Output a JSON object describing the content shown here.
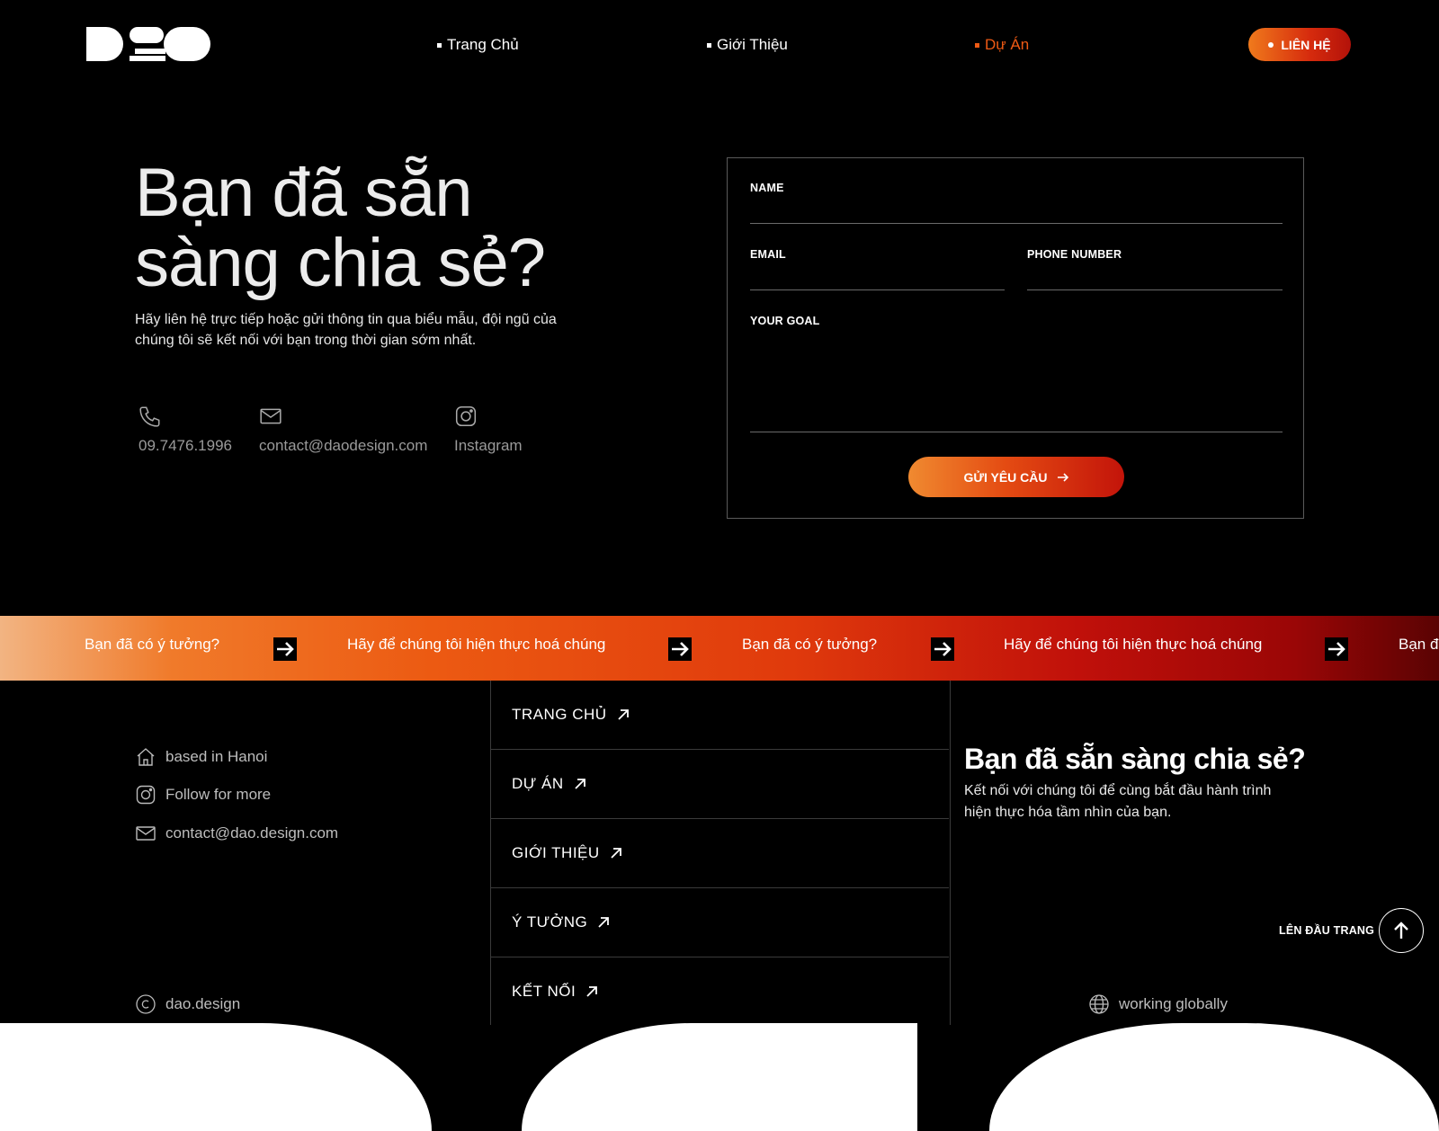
{
  "header": {
    "logo_text": "DAO",
    "nav": [
      {
        "label": "Trang Chủ",
        "active": false
      },
      {
        "label": "Giới Thiệu",
        "active": false
      },
      {
        "label": "Dự Án",
        "active": true
      }
    ],
    "contact_button": "LIÊN HỆ"
  },
  "hero": {
    "title_line1": "Bạn đã sẵn",
    "title_line2": "sàng chia sẻ?",
    "description": "Hãy liên hệ trực tiếp hoặc gửi thông tin qua biểu mẫu, đội ngũ của chúng tôi sẽ kết nối với bạn trong thời gian sớm nhất.",
    "contacts": [
      {
        "icon": "phone-icon",
        "value": "09.7476.1996"
      },
      {
        "icon": "mail-icon",
        "value": "contact@daodesign.com"
      },
      {
        "icon": "instagram-icon",
        "value": "Instagram"
      }
    ]
  },
  "form": {
    "name_label": "NAME",
    "email_label": "EMAIL",
    "phone_label": "PHONE NUMBER",
    "goal_label": "YOUR GOAL",
    "name_value": "",
    "email_value": "",
    "phone_value": "",
    "goal_value": "",
    "submit_label": "GỬI YÊU CẦU"
  },
  "marquee": {
    "items": [
      "Bạn đã có ý tưởng?",
      "Hãy để chúng tôi hiện thực hoá chúng",
      "Bạn đã có ý tưởng?",
      "Hãy để chúng tôi hiện thực hoá chúng",
      "Bạn đ"
    ]
  },
  "footer": {
    "info": [
      {
        "icon": "home-icon",
        "text": "based in Hanoi"
      },
      {
        "icon": "instagram-icon",
        "text": "Follow for more"
      },
      {
        "icon": "mail-icon",
        "text": "contact@dao.design.com"
      }
    ],
    "copyright": "dao.design",
    "menu": [
      {
        "label": "TRANG CHỦ"
      },
      {
        "label": "DỰ ÁN"
      },
      {
        "label": "GIỚI THIỆU"
      },
      {
        "label": "Ý TƯỞNG"
      },
      {
        "label": "KẾT NỐI"
      }
    ],
    "cta_title": "Bạn đã sẵn sàng chia sẻ?",
    "cta_desc": "Kết nối với chúng tôi để cùng bắt đầu hành trình hiện thực hóa tầm nhìn của bạn.",
    "back_to_top": "LÊN ĐẦU TRANG",
    "globe_text": "working globally"
  },
  "colors": {
    "accent": "#ef5a14",
    "gradient_start": "#f08a30",
    "gradient_end": "#c3140a",
    "background": "#000000"
  }
}
